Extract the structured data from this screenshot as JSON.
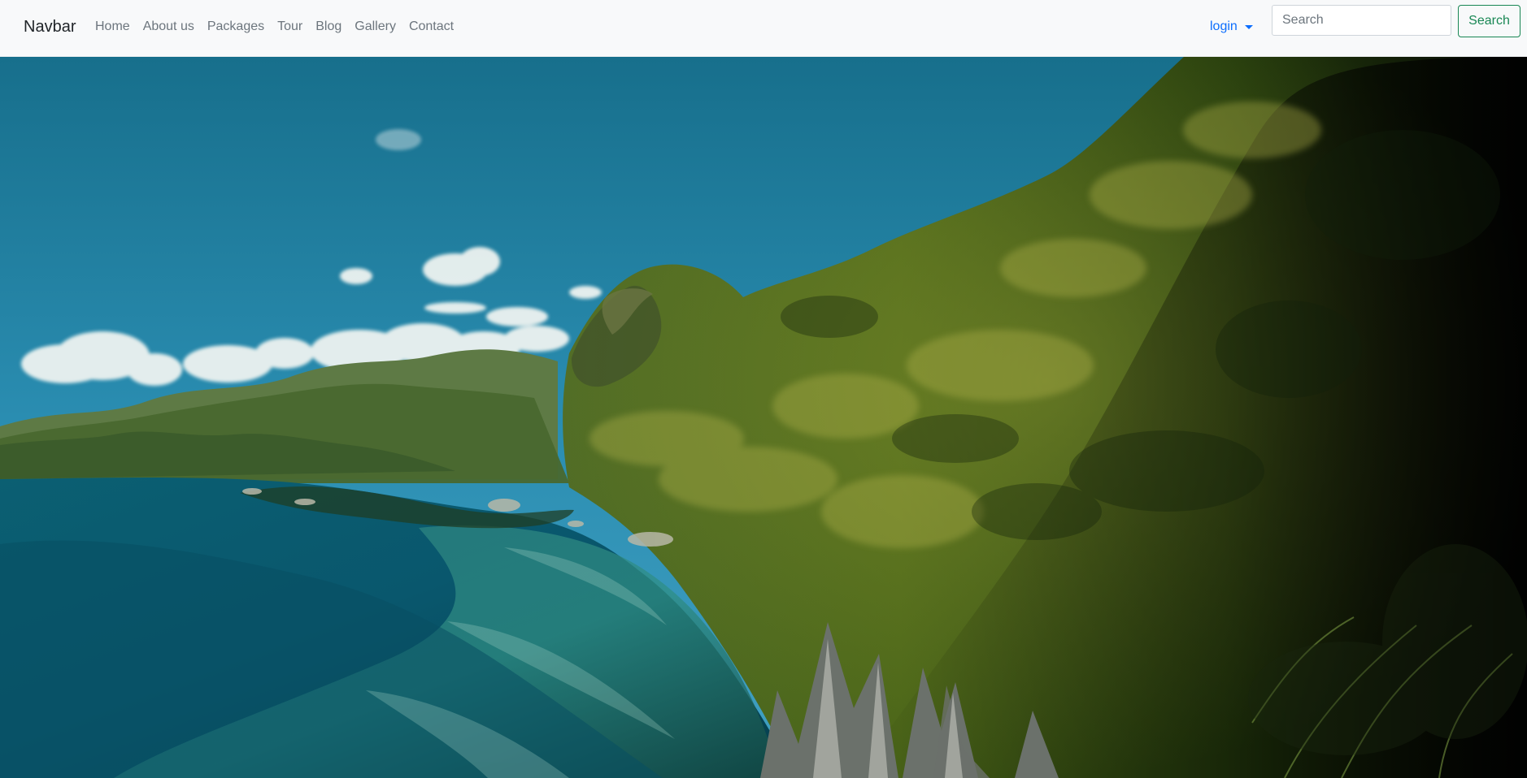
{
  "navbar": {
    "brand": "Navbar",
    "links": [
      {
        "label": "Home"
      },
      {
        "label": "About us"
      },
      {
        "label": "Packages"
      },
      {
        "label": "Tour"
      },
      {
        "label": "Blog"
      },
      {
        "label": "Gallery"
      },
      {
        "label": "Contact"
      }
    ],
    "login_label": "login",
    "search": {
      "placeholder": "Search",
      "value": "",
      "button_label": "Search"
    }
  },
  "colors": {
    "navbar_background": "#f8f9fa",
    "link": "#6c757d",
    "login": "#0d6efd",
    "search_button": "#198754"
  },
  "icons": {
    "login_dropdown": "chevron-down-icon"
  }
}
